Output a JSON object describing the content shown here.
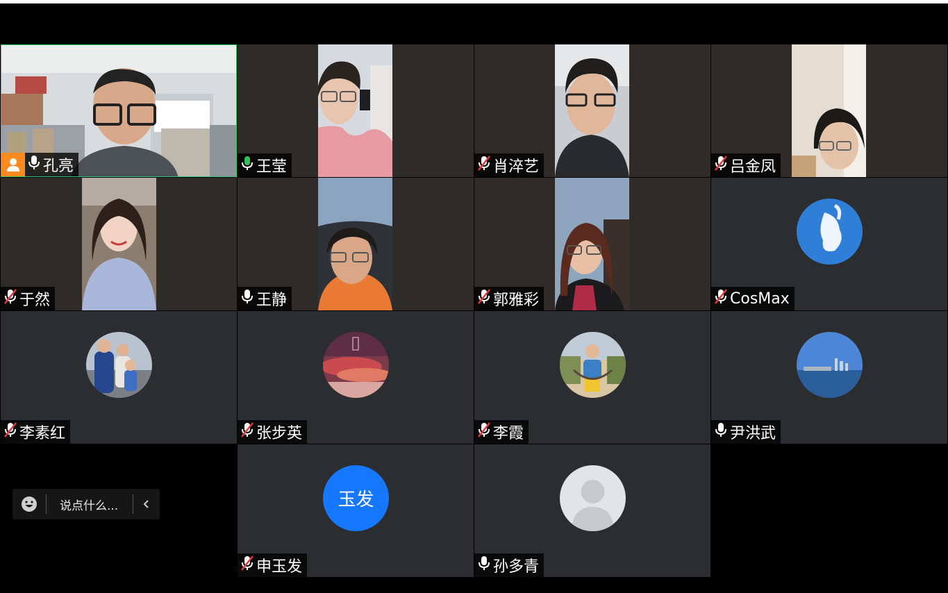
{
  "participants": [
    {
      "name": "孔亮",
      "mic": "on-white",
      "host": true
    },
    {
      "name": "王莹",
      "mic": "on-green"
    },
    {
      "name": "肖淬艺",
      "mic": "muted"
    },
    {
      "name": "吕金凤",
      "mic": "muted"
    },
    {
      "name": "于然",
      "mic": "muted"
    },
    {
      "name": "王静",
      "mic": "on-white"
    },
    {
      "name": "郭雅彩",
      "mic": "muted"
    },
    {
      "name": "CosMax",
      "mic": "muted"
    },
    {
      "name": "李素红",
      "mic": "muted"
    },
    {
      "name": "张步英",
      "mic": "muted"
    },
    {
      "name": "李霞",
      "mic": "muted"
    },
    {
      "name": "尹洪武",
      "mic": "on-white"
    },
    {
      "name": "申玉发",
      "mic": "muted",
      "initials": "玉发"
    },
    {
      "name": "孙多青",
      "mic": "on-white"
    }
  ],
  "chat": {
    "placeholder": "说点什么..."
  },
  "colors": {
    "active_border": "#31c76a",
    "host_badge": "#ff8a1f",
    "initials_bg": "#1677ff",
    "mute_slash": "#e23b3b"
  },
  "icons": {
    "mic_on": "microphone-icon",
    "mic_muted": "microphone-muted-icon",
    "host": "host-person-icon",
    "emoji": "emoji-icon",
    "collapse": "chevron-left-icon"
  }
}
